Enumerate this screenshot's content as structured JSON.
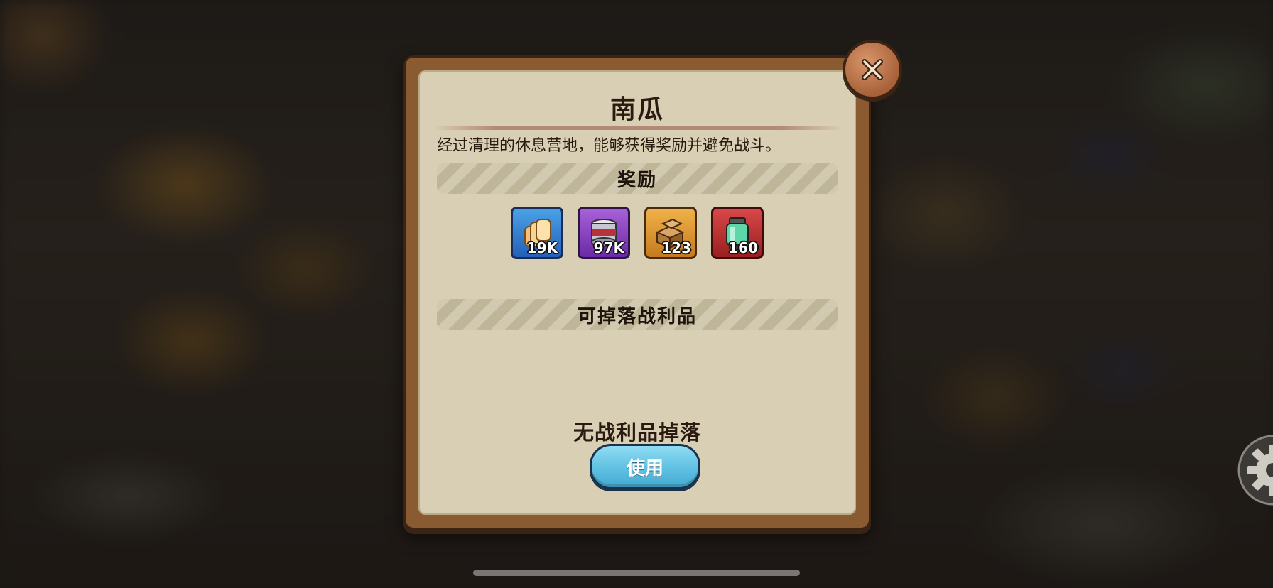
{
  "popup": {
    "title": "南瓜",
    "description": "经过清理的休息营地，能够获得奖励并避免战斗。",
    "rewards_header": "奖励",
    "loot_header": "可掉落战利品",
    "loot_empty": "无战利品掉落",
    "use_button": "使用"
  },
  "rewards": [
    {
      "icon": "bread-icon",
      "qty": "19K",
      "color": "#2f78cc"
    },
    {
      "icon": "can-icon",
      "qty": "97K",
      "color": "#8a3fc4"
    },
    {
      "icon": "crate-icon",
      "qty": "123",
      "color": "#dd9430"
    },
    {
      "icon": "canister-icon",
      "qty": "160",
      "color": "#c33636"
    }
  ],
  "icons": {
    "close": "close-icon",
    "settings": "gear-icon"
  }
}
